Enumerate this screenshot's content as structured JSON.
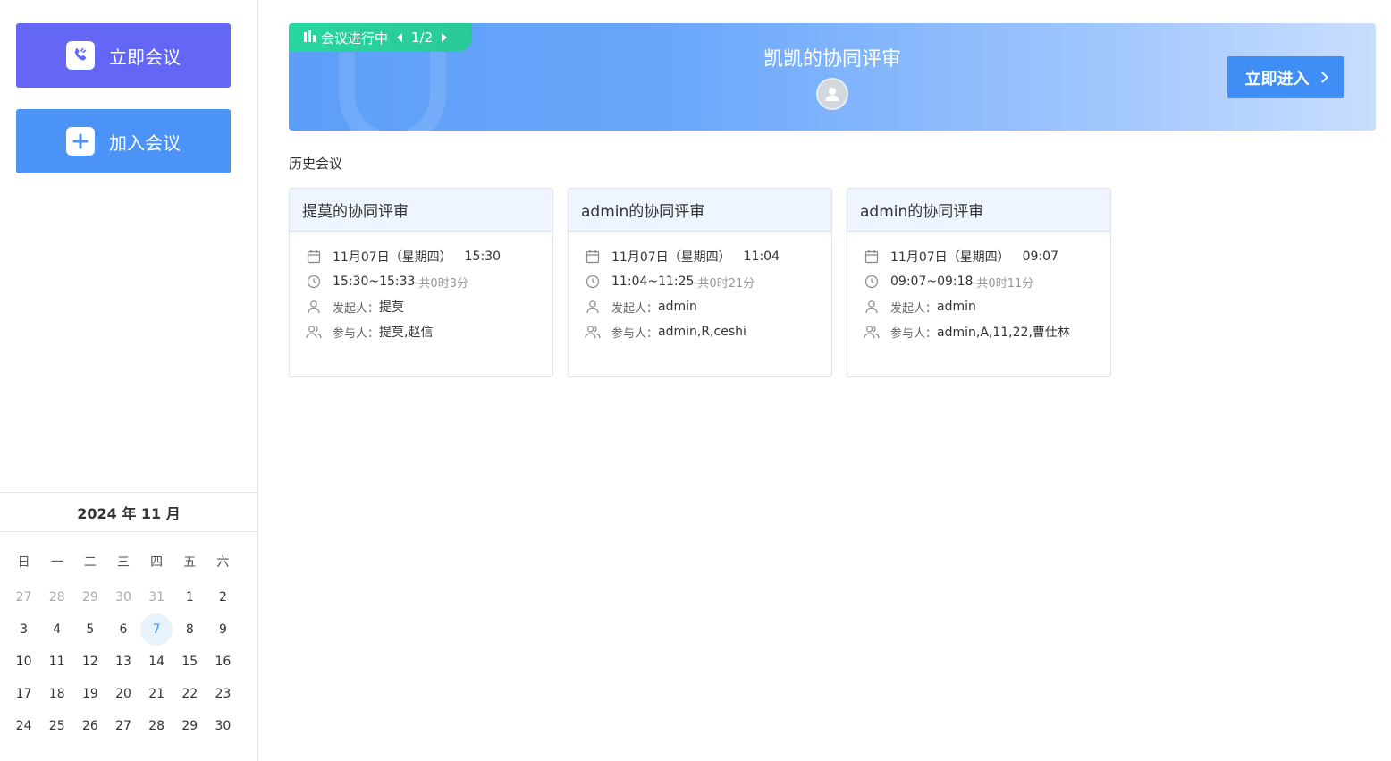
{
  "sidebar": {
    "start_meeting_label": "立即会议",
    "join_meeting_label": "加入会议"
  },
  "calendar": {
    "title": "2024 年 11 月",
    "weekdays": [
      "日",
      "一",
      "二",
      "三",
      "四",
      "五",
      "六"
    ],
    "weeks": [
      [
        "27",
        "28",
        "29",
        "30",
        "31",
        "1",
        "2"
      ],
      [
        "3",
        "4",
        "5",
        "6",
        "7",
        "8",
        "9"
      ],
      [
        "10",
        "11",
        "12",
        "13",
        "14",
        "15",
        "16"
      ],
      [
        "17",
        "18",
        "19",
        "20",
        "21",
        "22",
        "23"
      ],
      [
        "24",
        "25",
        "26",
        "27",
        "28",
        "29",
        "30"
      ]
    ],
    "today": "7"
  },
  "banner": {
    "status_label": "会议进行中",
    "pager": "1/2",
    "title": "凯凯的协同评审",
    "enter_label": "立即进入"
  },
  "history": {
    "section_title": "历史会议",
    "organizer_label": "发起人：",
    "participants_label": "参与人：",
    "cards": [
      {
        "title": "提莫的协同评审",
        "date": "11月07日（星期四）",
        "start": "15:30",
        "range": "15:30~15:33",
        "duration": "共0时3分",
        "organizer": "提莫",
        "participants": "提莫,赵信"
      },
      {
        "title": "admin的协同评审",
        "date": "11月07日（星期四）",
        "start": "11:04",
        "range": "11:04~11:25",
        "duration": "共0时21分",
        "organizer": "admin",
        "participants": "admin,R,ceshi"
      },
      {
        "title": "admin的协同评审",
        "date": "11月07日（星期四）",
        "start": "09:07",
        "range": "09:07~09:18",
        "duration": "共0时11分",
        "organizer": "admin",
        "participants": "admin,A,11,22,曹仕林"
      }
    ]
  }
}
